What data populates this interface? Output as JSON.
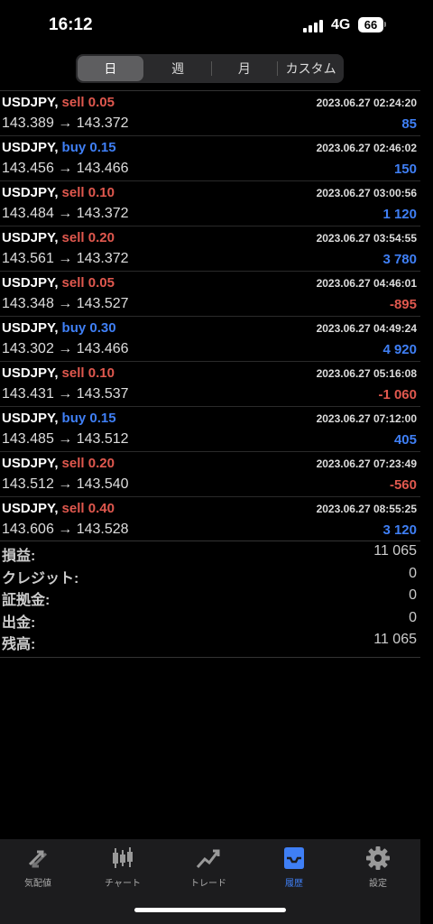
{
  "status": {
    "time": "16:12",
    "network": "4G",
    "battery": "66"
  },
  "segments": [
    {
      "label": "日",
      "active": true
    },
    {
      "label": "週",
      "active": false
    },
    {
      "label": "月",
      "active": false
    },
    {
      "label": "カスタム",
      "active": false
    }
  ],
  "trades": [
    {
      "symbol": "USDJPY,",
      "side": "sell",
      "volume": "0.05",
      "datetime": "2023.06.27 02:24:20",
      "prices": "143.389 → 143.372",
      "profit": "85"
    },
    {
      "symbol": "USDJPY,",
      "side": "buy",
      "volume": "0.15",
      "datetime": "2023.06.27 02:46:02",
      "prices": "143.456 → 143.466",
      "profit": "150"
    },
    {
      "symbol": "USDJPY,",
      "side": "sell",
      "volume": "0.10",
      "datetime": "2023.06.27 03:00:56",
      "prices": "143.484 → 143.372",
      "profit": "1 120"
    },
    {
      "symbol": "USDJPY,",
      "side": "sell",
      "volume": "0.20",
      "datetime": "2023.06.27 03:54:55",
      "prices": "143.561 → 143.372",
      "profit": "3 780"
    },
    {
      "symbol": "USDJPY,",
      "side": "sell",
      "volume": "0.05",
      "datetime": "2023.06.27 04:46:01",
      "prices": "143.348 → 143.527",
      "profit": "-895"
    },
    {
      "symbol": "USDJPY,",
      "side": "buy",
      "volume": "0.30",
      "datetime": "2023.06.27 04:49:24",
      "prices": "143.302 → 143.466",
      "profit": "4 920"
    },
    {
      "symbol": "USDJPY,",
      "side": "sell",
      "volume": "0.10",
      "datetime": "2023.06.27 05:16:08",
      "prices": "143.431 → 143.537",
      "profit": "-1 060"
    },
    {
      "symbol": "USDJPY,",
      "side": "buy",
      "volume": "0.15",
      "datetime": "2023.06.27 07:12:00",
      "prices": "143.485 → 143.512",
      "profit": "405"
    },
    {
      "symbol": "USDJPY,",
      "side": "sell",
      "volume": "0.20",
      "datetime": "2023.06.27 07:23:49",
      "prices": "143.512 → 143.540",
      "profit": "-560"
    },
    {
      "symbol": "USDJPY,",
      "side": "sell",
      "volume": "0.40",
      "datetime": "2023.06.27 08:55:25",
      "prices": "143.606 → 143.528",
      "profit": "3 120"
    }
  ],
  "summary": [
    {
      "label": "損益:",
      "value": "11 065"
    },
    {
      "label": "クレジット:",
      "value": "0"
    },
    {
      "label": "証拠金:",
      "value": "0"
    },
    {
      "label": "出金:",
      "value": "0"
    },
    {
      "label": "残高:",
      "value": "11 065"
    }
  ],
  "tabs": [
    {
      "label": "気配値",
      "icon": "quotes-arrows-icon",
      "active": false
    },
    {
      "label": "チャート",
      "icon": "candlestick-chart-icon",
      "active": false
    },
    {
      "label": "トレード",
      "icon": "trade-trend-icon",
      "active": false
    },
    {
      "label": "履歴",
      "icon": "history-inbox-icon",
      "active": true
    },
    {
      "label": "設定",
      "icon": "gear-icon",
      "active": false
    }
  ],
  "colors": {
    "sell": "#e0584e",
    "buy": "#3f7ff5",
    "active_tab": "#3f7ff5"
  }
}
